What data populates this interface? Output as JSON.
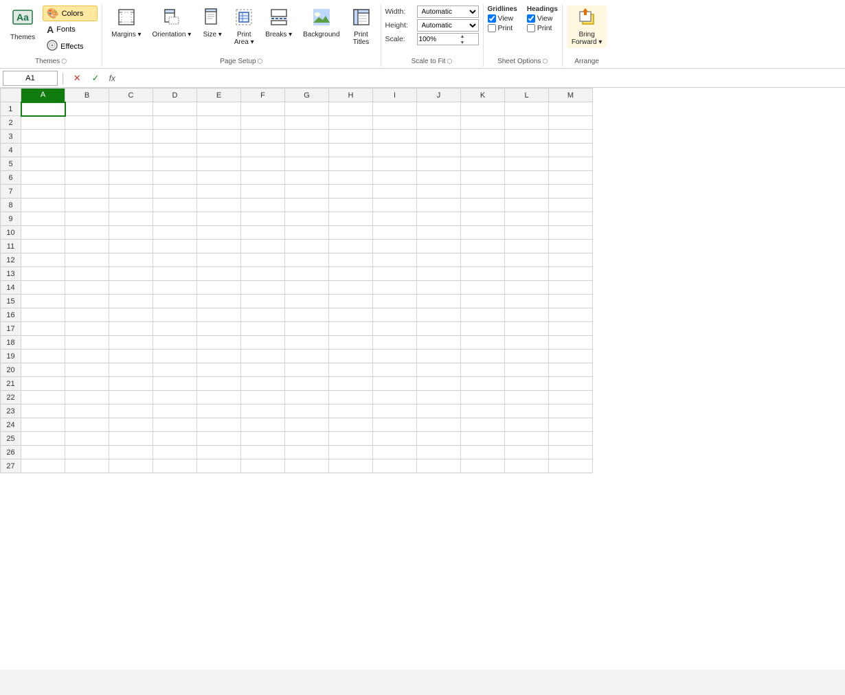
{
  "ribbon": {
    "groups": [
      {
        "id": "themes",
        "label": "Themes",
        "buttons": [
          {
            "id": "themes-btn",
            "label": "Themes",
            "icon": "🎨",
            "type": "big"
          },
          {
            "id": "colors-btn",
            "label": "Colors",
            "icon": "🎨",
            "type": "small",
            "highlighted": true
          },
          {
            "id": "fonts-btn",
            "label": "Fonts",
            "icon": "A",
            "type": "small"
          },
          {
            "id": "effects-btn",
            "label": "Effects",
            "icon": "✨",
            "type": "small"
          }
        ]
      },
      {
        "id": "page-setup",
        "label": "Page Setup",
        "buttons": [
          {
            "id": "margins-btn",
            "label": "Margins",
            "icon": "▦",
            "type": "big"
          },
          {
            "id": "orientation-btn",
            "label": "Orientation",
            "icon": "⬜",
            "type": "big"
          },
          {
            "id": "size-btn",
            "label": "Size",
            "icon": "📄",
            "type": "big"
          },
          {
            "id": "print-area-btn",
            "label": "Print\nArea",
            "icon": "📋",
            "type": "big"
          },
          {
            "id": "breaks-btn",
            "label": "Breaks",
            "icon": "⊟",
            "type": "big"
          },
          {
            "id": "background-btn",
            "label": "Background",
            "icon": "🖼",
            "type": "big"
          },
          {
            "id": "print-titles-btn",
            "label": "Print\nTitles",
            "icon": "≡",
            "type": "big"
          }
        ]
      },
      {
        "id": "scale-to-fit",
        "label": "Scale to Fit",
        "width_label": "Width:",
        "width_value": "Automatic",
        "height_label": "Height:",
        "height_value": "Automatic",
        "scale_label": "Scale:",
        "scale_value": "100%"
      },
      {
        "id": "sheet-options",
        "label": "Sheet Options",
        "gridlines_label": "Gridlines",
        "headings_label": "Headings",
        "view_label": "View",
        "print_label": "Print",
        "gridlines_view_checked": true,
        "gridlines_print_checked": false,
        "headings_view_checked": true,
        "headings_print_checked": false
      },
      {
        "id": "arrange",
        "label": "Arrange",
        "buttons": [
          {
            "id": "bring-forward-btn",
            "label": "Bring\nForward",
            "icon": "⬆",
            "type": "big",
            "highlighted": true
          }
        ]
      }
    ]
  },
  "formula_bar": {
    "name_box_value": "A1",
    "cancel_label": "✕",
    "confirm_label": "✓",
    "fx_label": "fx",
    "formula_value": ""
  },
  "spreadsheet": {
    "columns": [
      "A",
      "B",
      "C",
      "D",
      "E",
      "F",
      "G",
      "H",
      "I",
      "J",
      "K",
      "L",
      "M"
    ],
    "selected_cell": "A1",
    "selected_col": "A",
    "row_count": 27
  }
}
